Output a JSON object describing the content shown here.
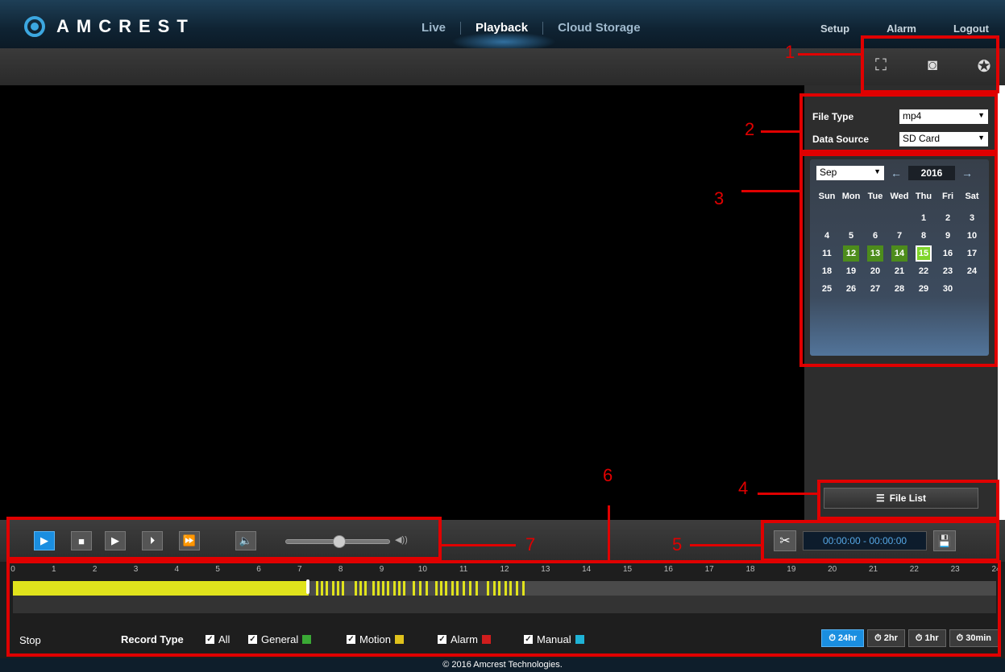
{
  "header": {
    "logo_text": "AMCREST",
    "nav": [
      "Live",
      "Playback",
      "Cloud Storage"
    ],
    "active_nav": "Playback",
    "top_right": [
      "Setup",
      "Alarm",
      "Logout"
    ]
  },
  "toolbar": {
    "icons": [
      "crop-zoom-icon",
      "snapshot-camera-icon",
      "fullscreen-icon"
    ]
  },
  "panel": {
    "file_type_label": "File Type",
    "file_type_value": "mp4",
    "data_source_label": "Data Source",
    "data_source_value": "SD Card",
    "file_list_label": "File List"
  },
  "calendar": {
    "month": "Sep",
    "year": "2016",
    "day_headers": [
      "Sun",
      "Mon",
      "Tue",
      "Wed",
      "Thu",
      "Fri",
      "Sat"
    ],
    "weeks": [
      [
        "",
        "",
        "",
        "",
        "1",
        "2",
        "3"
      ],
      [
        "4",
        "5",
        "6",
        "7",
        "8",
        "9",
        "10"
      ],
      [
        "11",
        "12",
        "13",
        "14",
        "15",
        "16",
        "17"
      ],
      [
        "18",
        "19",
        "20",
        "21",
        "22",
        "23",
        "24"
      ],
      [
        "25",
        "26",
        "27",
        "28",
        "29",
        "30",
        ""
      ]
    ],
    "days_with_recordings": [
      "12",
      "13",
      "14"
    ],
    "selected_day": "15"
  },
  "controls": {
    "clip_time_range": "00:00:00 - 00:00:00"
  },
  "timeline": {
    "hours": [
      "0",
      "1",
      "2",
      "3",
      "4",
      "5",
      "6",
      "7",
      "8",
      "9",
      "10",
      "11",
      "12",
      "13",
      "14",
      "15",
      "16",
      "17",
      "18",
      "19",
      "20",
      "21",
      "22",
      "23",
      "24"
    ],
    "status": "Stop",
    "record_type_label": "Record Type",
    "record_types": [
      {
        "label": "All",
        "color": ""
      },
      {
        "label": "General",
        "color": "#3aa935"
      },
      {
        "label": "Motion",
        "color": "#e0c21c"
      },
      {
        "label": "Alarm",
        "color": "#d01d1d"
      },
      {
        "label": "Manual",
        "color": "#1fb3d6"
      }
    ],
    "ranges": [
      "24hr",
      "2hr",
      "1hr",
      "30min"
    ],
    "active_range": "24hr"
  },
  "annotations": [
    "1",
    "2",
    "3",
    "4",
    "5",
    "6",
    "7"
  ],
  "footer": "© 2016 Amcrest Technologies."
}
